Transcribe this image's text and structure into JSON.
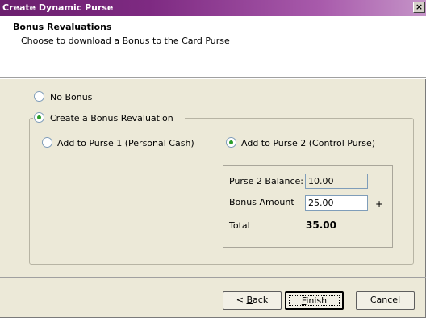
{
  "window": {
    "title": "Create Dynamic Purse",
    "close_label": "×"
  },
  "header": {
    "title": "Bonus Revaluations",
    "subtitle": "Choose to download a Bonus to the Card Purse"
  },
  "options": {
    "no_bonus": {
      "label": "No Bonus",
      "selected": false
    },
    "create_bonus": {
      "label": "Create a Bonus Revaluation",
      "selected": true
    }
  },
  "purse_choice": {
    "purse1": {
      "label": "Add to Purse 1 (Personal Cash)",
      "selected": false
    },
    "purse2": {
      "label": "Add to Purse 2 (Control Purse)",
      "selected": true
    }
  },
  "details": {
    "balance_label": "Purse 2 Balance:",
    "balance_value": "10.00",
    "bonus_label": "Bonus Amount",
    "bonus_value": "25.00",
    "plus_sign": "+",
    "total_label": "Total",
    "total_value": "35.00"
  },
  "buttons": {
    "back_prefix": "< ",
    "back_mnemonic": "B",
    "back_rest": "ack",
    "finish_mnemonic": "F",
    "finish_rest": "inish",
    "cancel": "Cancel"
  }
}
